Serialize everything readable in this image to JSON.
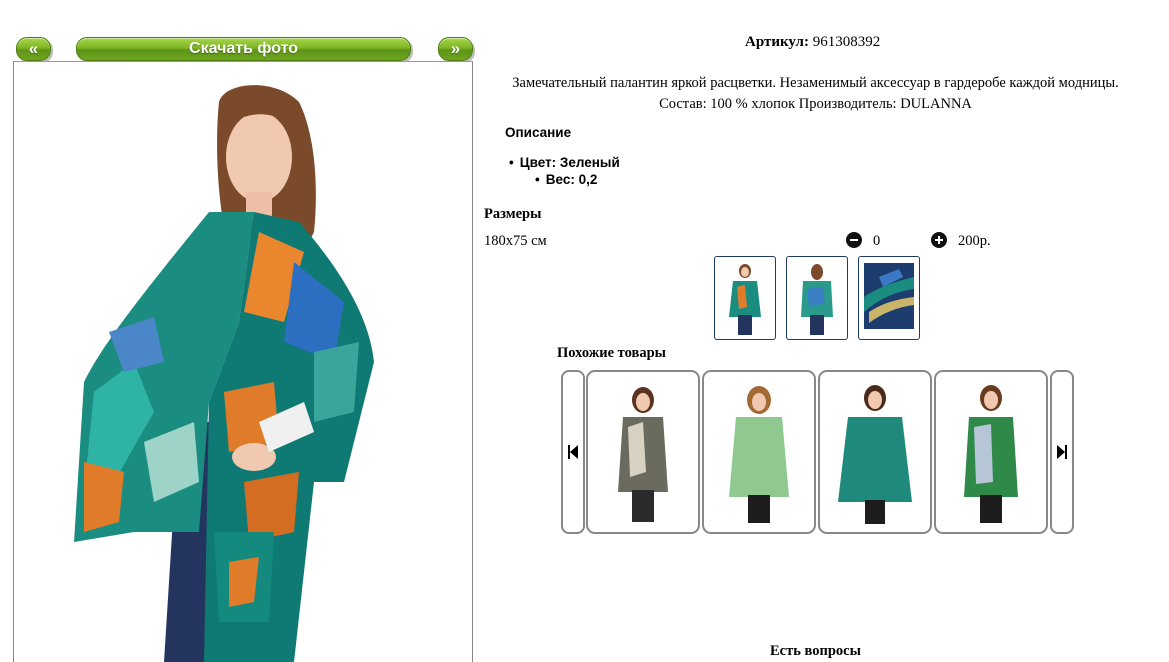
{
  "nav": {
    "prev_label": "«",
    "download_label": "Скачать фото",
    "next_label": "»"
  },
  "product": {
    "article_label": "Артикул:",
    "article_value": "961308392",
    "description_line1": "Замечательный палантин яркой расцветки. Незаменимый аксессуар в гардеробе каждой модницы.",
    "description_line2": "Состав: 100 % хлопок Производитель: DULANNA",
    "section_title": "Описание",
    "color_item": "Цвет: Зеленый",
    "weight_item": "Вес: 0,2"
  },
  "sizes": {
    "title": "Размеры",
    "size_value": "180х75 см",
    "quantity": "0",
    "price": "200р."
  },
  "similar": {
    "title": "Похожие товары"
  },
  "footer": {
    "cut_text": "Есть вопросы"
  },
  "colors": {
    "accent_green": "#7db523",
    "scarf_teal": "#1a8c80",
    "thumb_border": "#1f3a5f"
  }
}
